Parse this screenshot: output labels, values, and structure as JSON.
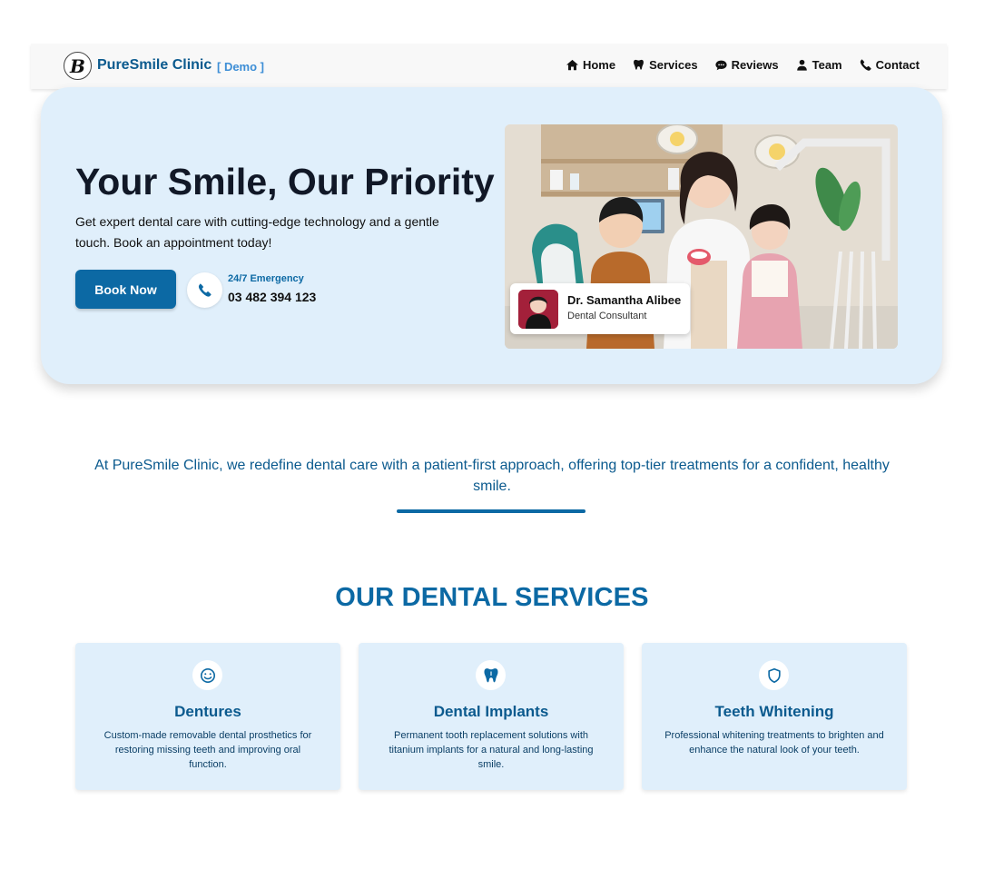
{
  "brand": {
    "logo_letter": "B",
    "name": "PureSmile Clinic",
    "tag": "[ Demo ]"
  },
  "nav": {
    "items": [
      {
        "label": "Home",
        "icon": "home-icon"
      },
      {
        "label": "Services",
        "icon": "tooth-icon"
      },
      {
        "label": "Reviews",
        "icon": "comment-icon"
      },
      {
        "label": "Team",
        "icon": "user-icon"
      },
      {
        "label": "Contact",
        "icon": "phone-icon"
      }
    ]
  },
  "hero": {
    "title": "Your Smile, Our Priority",
    "description": "Get expert dental care with cutting-edge technology and a gentle touch. Book an appointment today!",
    "book_label": "Book Now",
    "emergency_label": "24/7 Emergency",
    "emergency_number": "03 482 394 123",
    "doctor": {
      "name": "Dr. Samantha Alibee",
      "role": "Dental Consultant"
    }
  },
  "intro": {
    "text": "At PureSmile Clinic, we redefine dental care with a patient-first approach, offering top-tier treatments for a confident, healthy smile."
  },
  "services": {
    "title": "OUR DENTAL SERVICES",
    "items": [
      {
        "title": "Dentures",
        "icon": "smile-icon",
        "description": "Custom-made removable dental prosthetics for restoring missing teeth and improving oral function."
      },
      {
        "title": "Dental Implants",
        "icon": "tooth-icon",
        "description": "Permanent tooth replacement solutions with titanium implants for a natural and long-lasting smile."
      },
      {
        "title": "Teeth Whitening",
        "icon": "shield-icon",
        "description": "Professional whitening treatments to brighten and enhance the natural look of your teeth."
      }
    ]
  },
  "colors": {
    "primary": "#0c69a4",
    "brand_text": "#0b5a8e",
    "demo_tag": "#3d8ed6",
    "hero_bg": "#e0effb",
    "card_bg": "#e0effb"
  }
}
